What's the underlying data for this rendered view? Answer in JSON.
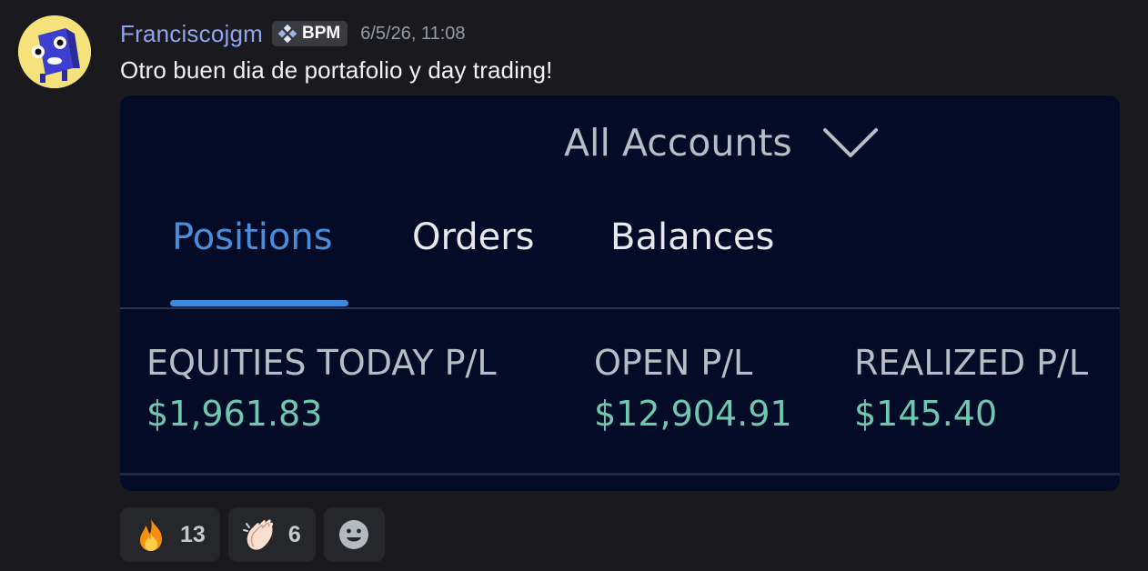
{
  "message": {
    "username": "Franciscojgm",
    "role_tag": "BPM",
    "timestamp": "6/5/26, 11:08",
    "text": "Otro buen dia de portafolio y day trading!",
    "username_color": "#8fa4f0"
  },
  "attachment": {
    "account_selector": "All Accounts",
    "tabs": [
      {
        "label": "Positions",
        "active": true
      },
      {
        "label": "Orders",
        "active": false
      },
      {
        "label": "Balances",
        "active": false
      }
    ],
    "metrics": [
      {
        "label": "EQUITIES TODAY P/L",
        "value": "$1,961.83"
      },
      {
        "label": "OPEN P/L",
        "value": "$12,904.91"
      },
      {
        "label": "REALIZED P/L",
        "value": "$145.40"
      }
    ],
    "accent_color": "#3c89de",
    "value_color": "#6fc9b0"
  },
  "reactions": [
    {
      "emoji": "fire-emoji",
      "count": "13"
    },
    {
      "emoji": "clapping-hands-emoji",
      "count": "6"
    }
  ]
}
